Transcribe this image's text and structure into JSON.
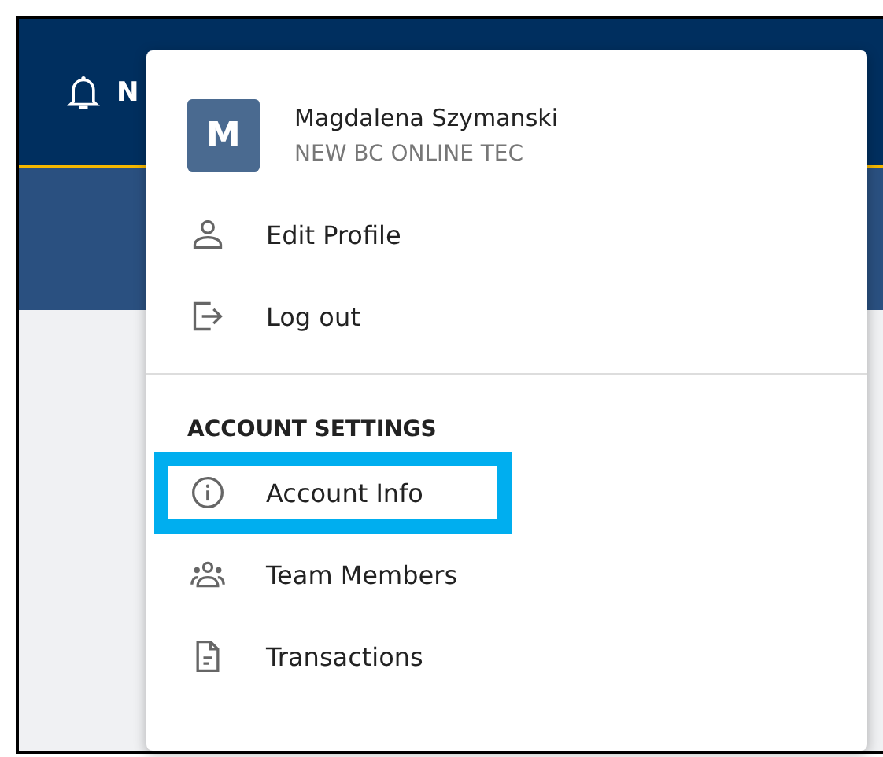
{
  "header": {
    "notifications_label": "N"
  },
  "user_menu": {
    "avatar_initial": "M",
    "name": "Magdalena Szymanski",
    "company": "NEW BC ONLINE TEC",
    "items": [
      {
        "label": "Edit Profile",
        "kind": "person",
        "highlighted": false
      },
      {
        "label": "Log out",
        "kind": "logout",
        "highlighted": false
      }
    ],
    "section_title": "ACCOUNT SETTINGS",
    "settings_items": [
      {
        "label": "Account Info",
        "kind": "info",
        "highlighted": true
      },
      {
        "label": "Team Members",
        "kind": "team",
        "highlighted": false
      },
      {
        "label": "Transactions",
        "kind": "document",
        "highlighted": false
      }
    ]
  }
}
